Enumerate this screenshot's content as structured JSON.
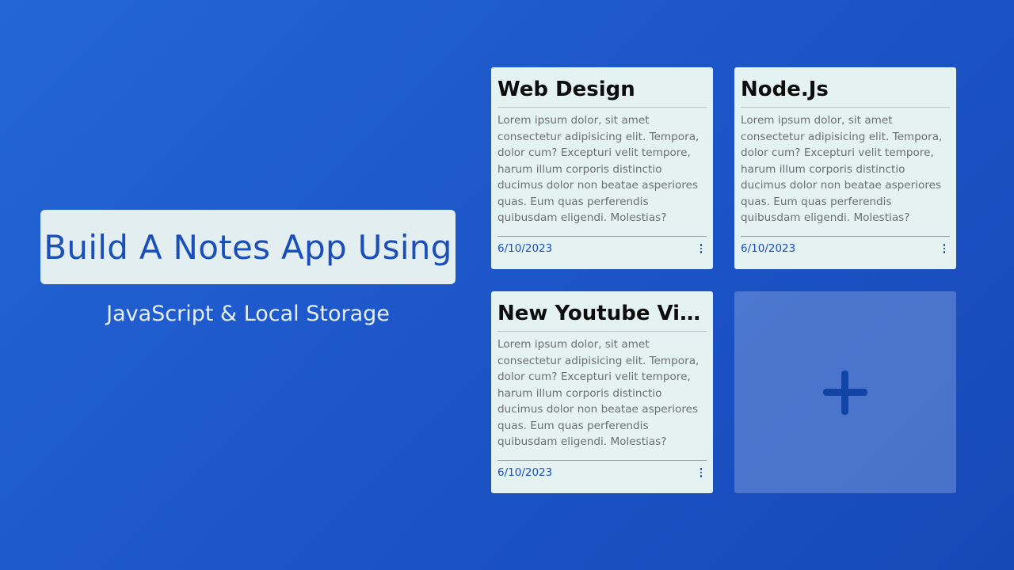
{
  "hero": {
    "title": "Build A Notes App Using",
    "subtitle": "JavaScript & Local Storage"
  },
  "notes": [
    {
      "title": "Web Design",
      "body": "Lorem ipsum dolor, sit amet consectetur adipisicing elit. Tempora, dolor cum? Excepturi velit tempore, harum illum corporis distinctio ducimus dolor non beatae asperiores quas. Eum quas perferendis quibusdam eligendi. Molestias?",
      "date": "6/10/2023",
      "menu_icon": "more-vertical-icon"
    },
    {
      "title": "Node.Js",
      "body": "Lorem ipsum dolor, sit amet consectetur adipisicing elit. Tempora, dolor cum? Excepturi velit tempore, harum illum corporis distinctio ducimus dolor non beatae asperiores quas. Eum quas perferendis quibusdam eligendi. Molestias?",
      "date": "6/10/2023",
      "menu_icon": "more-vertical-icon"
    },
    {
      "title": "New Youtube Vid...",
      "body": "Lorem ipsum dolor, sit amet consectetur adipisicing elit. Tempora, dolor cum? Excepturi velit tempore, harum illum corporis distinctio ducimus dolor non beatae asperiores quas. Eum quas perferendis quibusdam eligendi. Molestias?",
      "date": "6/10/2023",
      "menu_icon": "more-vertical-icon"
    }
  ],
  "add_note": {
    "icon": "plus-icon"
  },
  "colors": {
    "background_start": "#2466d6",
    "background_end": "#1748b8",
    "accent": "#1a4fba",
    "card": "#e4f2f2"
  }
}
